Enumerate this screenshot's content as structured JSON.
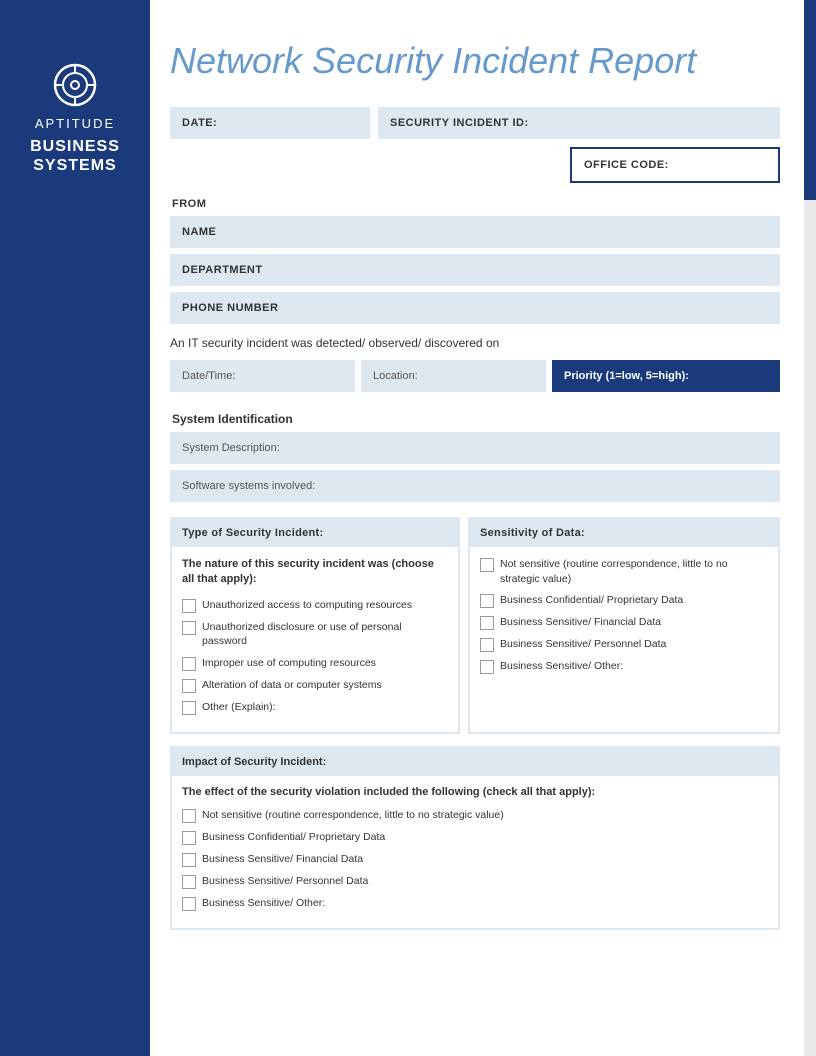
{
  "sidebar": {
    "aptitude_label": "APTITUDE",
    "business_label": "BUSINESS\nSYSTEMS",
    "icon_label": "target-icon"
  },
  "header": {
    "title": "Network Security Incident Report"
  },
  "form": {
    "date_label": "DATE:",
    "security_incident_id_label": "SECURITY INCIDENT ID:",
    "office_code_label": "OFFICE CODE:",
    "from_label": "FROM",
    "name_label": "NAME",
    "department_label": "DEPARTMENT",
    "phone_label": "PHONE NUMBER",
    "it_security_text": "An IT security incident was detected/ observed/ discovered on",
    "date_time_label": "Date/Time:",
    "location_label": "Location:",
    "priority_label": "Priority (1=low, 5=high):",
    "system_identification_label": "System Identification",
    "system_description_label": "System Description:",
    "software_systems_label": "Software systems involved:",
    "type_of_security_incident_label": "Type of Security Incident:",
    "nature_subtitle": "The nature of this security incident was (choose all that apply):",
    "checkboxes_incident": [
      "Unauthorized access to computing resources",
      "Unauthorized disclosure or use of personal password",
      "Improper use of computing resources",
      "Alteration of data or computer systems",
      "Other (Explain):"
    ],
    "sensitivity_of_data_label": "Sensitivity of Data:",
    "checkboxes_sensitivity": [
      "Not sensitive (routine correspondence, little to no strategic value)",
      "Business Confidential/ Proprietary Data",
      "Business Sensitive/ Financial Data",
      "Business Sensitive/ Personnel Data",
      "Business Sensitive/ Other:"
    ],
    "impact_label": "Impact of Security Incident:",
    "impact_subtitle": "The effect of the security violation included the following (check all that apply):",
    "checkboxes_impact": [
      "Not sensitive (routine correspondence, little to no strategic value)",
      "Business Confidential/ Proprietary Data",
      "Business Sensitive/ Financial Data",
      "Business Sensitive/ Personnel Data",
      "Business Sensitive/ Other:"
    ]
  }
}
